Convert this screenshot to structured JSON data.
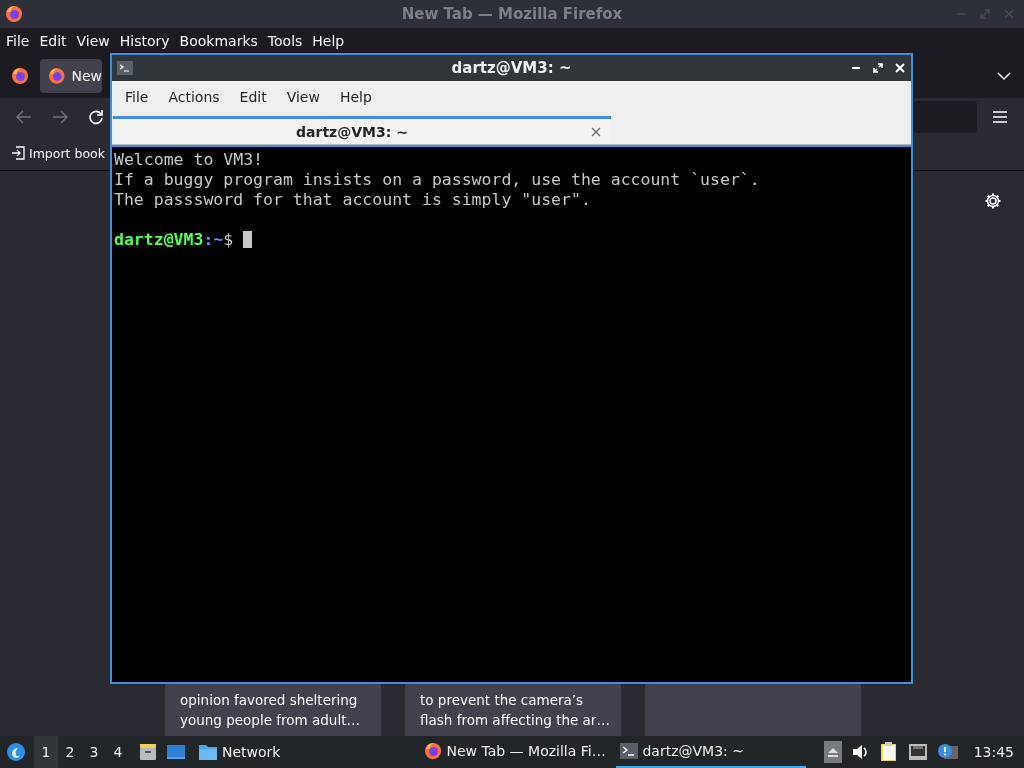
{
  "firefox": {
    "title": "New Tab — Mozilla Firefox",
    "menu": [
      "File",
      "Edit",
      "View",
      "History",
      "Bookmarks",
      "Tools",
      "Help"
    ],
    "tabs": [
      {
        "label": "New",
        "selected": true
      }
    ],
    "bookmarks": [
      "Import book"
    ],
    "cards": [
      {
        "kind": "summary",
        "lines": [
          "opinion favored sheltering",
          "young people from adult…"
        ]
      },
      {
        "kind": "summary",
        "lines": [
          "to prevent the camera’s",
          "flash from affecting the ar…"
        ]
      },
      {
        "kind": "blank"
      }
    ]
  },
  "terminal": {
    "title": "dartz@VM3: ~",
    "menu": [
      "File",
      "Actions",
      "Edit",
      "View",
      "Help"
    ],
    "tabs": [
      {
        "label": "dartz@VM3: ~",
        "selected": true
      }
    ],
    "output": [
      "Welcome to VM3!",
      "If a buggy program insists on a password, use the account `user`.",
      "The passsword for that account is simply \"user\"."
    ],
    "prompt": {
      "user_host": "dartz@VM3",
      "path": ":~",
      "symbol": "$ "
    }
  },
  "taskbar": {
    "workspaces": [
      {
        "label": "1",
        "selected": true
      },
      {
        "label": "2",
        "selected": false
      },
      {
        "label": "3",
        "selected": false
      },
      {
        "label": "4",
        "selected": false
      }
    ],
    "places": [
      "Network"
    ],
    "tasks": [
      {
        "kind": "browser",
        "label": "New Tab — Mozilla Fi…",
        "selected": false
      },
      {
        "kind": "terminal",
        "label": "dartz@VM3: ~",
        "selected": true
      }
    ],
    "clock": "13:45"
  }
}
